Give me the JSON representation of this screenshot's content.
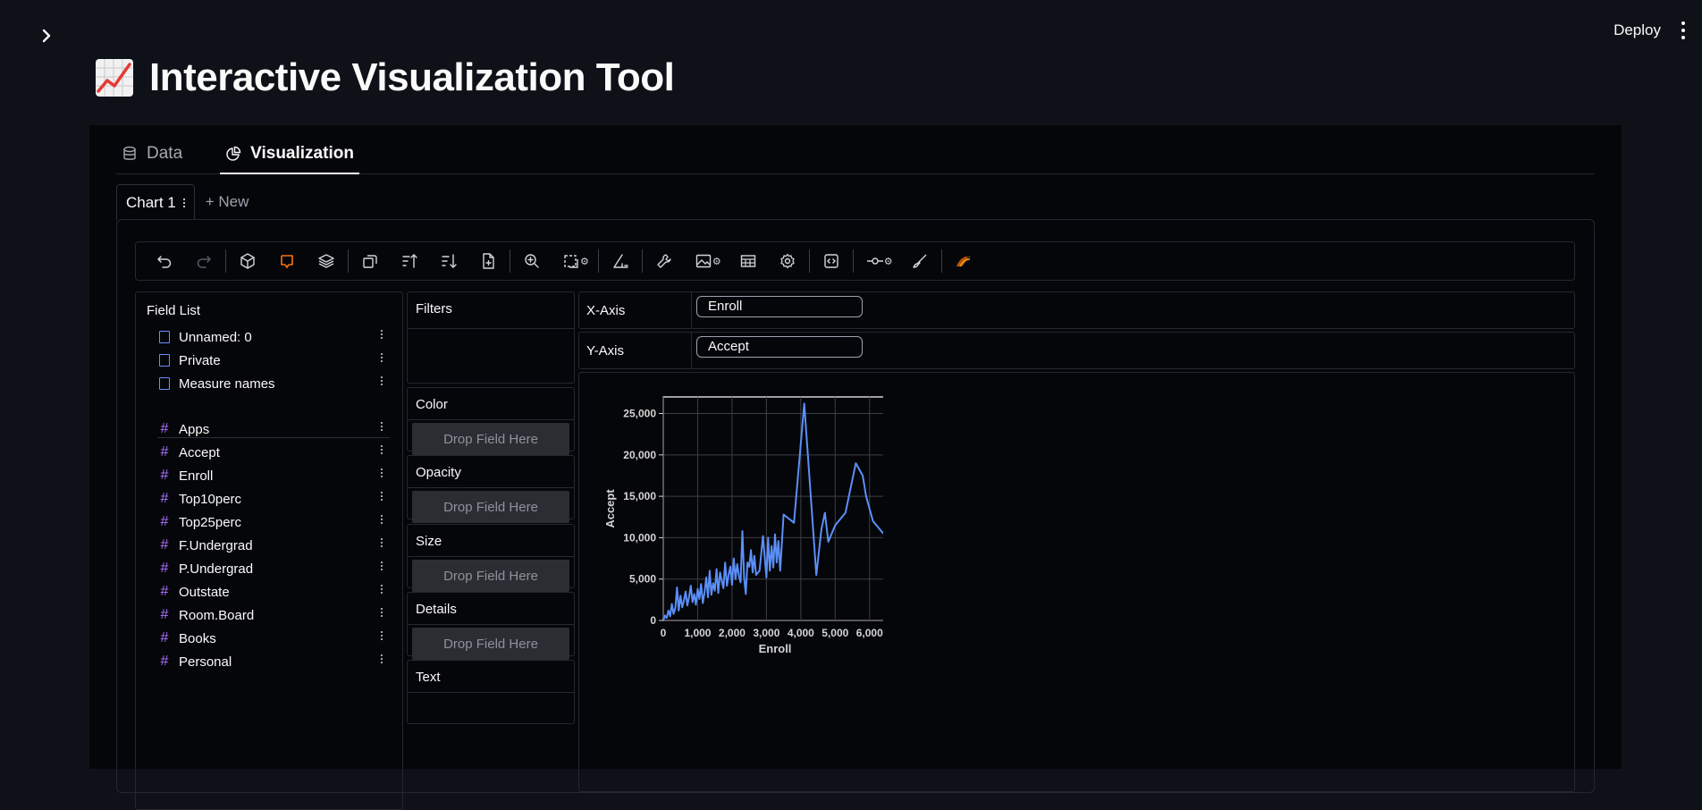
{
  "header": {
    "deploy_label": "Deploy",
    "title": "Interactive Visualization Tool",
    "title_icon": "chart-increasing-emoji"
  },
  "tabs": [
    {
      "label": "Data",
      "icon": "database-icon",
      "active": false
    },
    {
      "label": "Visualization",
      "icon": "pie-chart-icon",
      "active": true
    }
  ],
  "chart_tabs": {
    "current": "Chart 1",
    "new_label": "+ New"
  },
  "toolbar": {
    "buttons": [
      "undo-icon",
      "redo-icon",
      "cube-icon",
      "lasso-icon",
      "layers-icon",
      "transpose-icon",
      "sort-ascending-icon",
      "sort-descending-icon",
      "add-file-icon",
      "zoom-icon",
      "fit-icon",
      "axes-icon",
      "wrench-icon",
      "image-icon",
      "table-icon",
      "settings-icon",
      "code-icon",
      "line-point-icon",
      "brush-icon",
      "kanaries-logo"
    ],
    "accent": "#f97316"
  },
  "field_list": {
    "title": "Field List",
    "dimensions": [
      "Unnamed: 0",
      "Private",
      "Measure names"
    ],
    "measures": [
      "Apps",
      "Accept",
      "Enroll",
      "Top10perc",
      "Top25perc",
      "F.Undergrad",
      "P.Undergrad",
      "Outstate",
      "Room.Board",
      "Books",
      "Personal"
    ]
  },
  "shelves": {
    "filters": "Filters",
    "color": "Color",
    "opacity": "Opacity",
    "size": "Size",
    "details": "Details",
    "text": "Text",
    "drop_placeholder": "Drop Field Here"
  },
  "encodings": {
    "x_label": "X-Axis",
    "x_field": "Enroll",
    "y_label": "Y-Axis",
    "y_field": "Accept"
  },
  "chart_data": {
    "type": "line",
    "xlabel": "Enroll",
    "ylabel": "Accept",
    "xlim": [
      0,
      6500
    ],
    "ylim": [
      0,
      27000
    ],
    "xticks": [
      0,
      1000,
      2000,
      3000,
      4000,
      5000,
      6000
    ],
    "yticks": [
      0,
      5000,
      10000,
      15000,
      20000,
      25000
    ],
    "xtick_labels": [
      "0",
      "1,000",
      "2,000",
      "3,000",
      "4,000",
      "5,000",
      "6,000"
    ],
    "ytick_labels": [
      "0",
      "5,000",
      "10,000",
      "15,000",
      "20,000",
      "25,000"
    ],
    "grid": true,
    "color": "#5b8ff9",
    "x": [
      0,
      50,
      100,
      150,
      200,
      250,
      300,
      350,
      400,
      450,
      500,
      550,
      600,
      650,
      700,
      750,
      800,
      850,
      900,
      950,
      1000,
      1050,
      1100,
      1150,
      1200,
      1250,
      1300,
      1350,
      1400,
      1450,
      1500,
      1550,
      1600,
      1650,
      1700,
      1750,
      1800,
      1850,
      1900,
      1950,
      2000,
      2050,
      2100,
      2150,
      2200,
      2250,
      2300,
      2350,
      2400,
      2450,
      2500,
      2550,
      2600,
      2650,
      2700,
      2800,
      2900,
      3000,
      3050,
      3100,
      3150,
      3200,
      3250,
      3300,
      3350,
      3400,
      3500,
      3800,
      4100,
      4450,
      4600,
      4700,
      4800,
      5000,
      5300,
      5600,
      5800,
      5900,
      6100,
      6400
    ],
    "y": [
      0,
      600,
      300,
      1200,
      500,
      2000,
      800,
      1500,
      4000,
      1200,
      3000,
      1600,
      2400,
      3500,
      1800,
      2800,
      4200,
      2200,
      3200,
      1900,
      3800,
      2600,
      4400,
      2100,
      3400,
      5200,
      2800,
      6000,
      3100,
      4500,
      3600,
      6200,
      3300,
      5800,
      4800,
      3900,
      7000,
      4200,
      5500,
      6500,
      4300,
      7500,
      5000,
      6800,
      5400,
      4600,
      10800,
      5200,
      3200,
      7000,
      6500,
      8500,
      5800,
      7800,
      5500,
      6000,
      10200,
      5200,
      10000,
      6000,
      9000,
      6400,
      10400,
      7000,
      9600,
      6000,
      12800,
      11800,
      26200,
      5500,
      11000,
      13000,
      9500,
      11500,
      13000,
      19000,
      17500,
      15000,
      12000,
      10500
    ]
  }
}
